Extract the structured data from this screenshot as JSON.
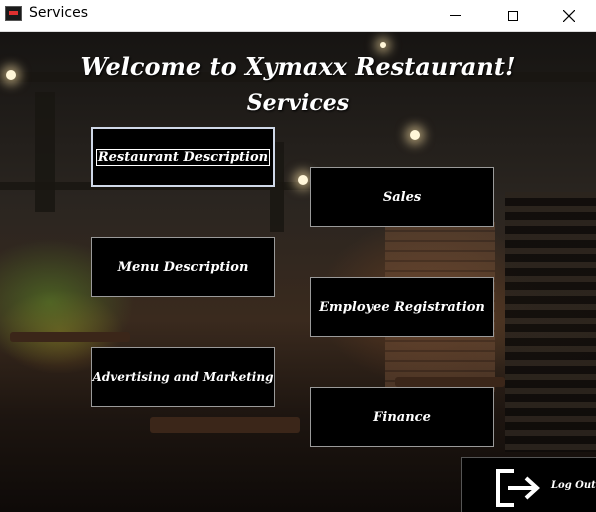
{
  "window": {
    "title": "Services",
    "controls": {
      "minimize": "minimize-icon",
      "maximize": "maximize-icon",
      "close": "close-icon"
    }
  },
  "header": {
    "welcome": "Welcome to Xymaxx Restaurant!",
    "section": "Services"
  },
  "buttons": {
    "restaurant_description": "Restaurant Description",
    "sales": "Sales",
    "menu_description": "Menu Description",
    "employee_registration": "Employee Registration",
    "advertising_marketing": "Advertising and Marketing",
    "finance": "Finance",
    "logout": "Log Out"
  },
  "colors": {
    "button_bg": "#000000",
    "button_text": "#ffffff",
    "button_border": "#9a9a9a"
  }
}
